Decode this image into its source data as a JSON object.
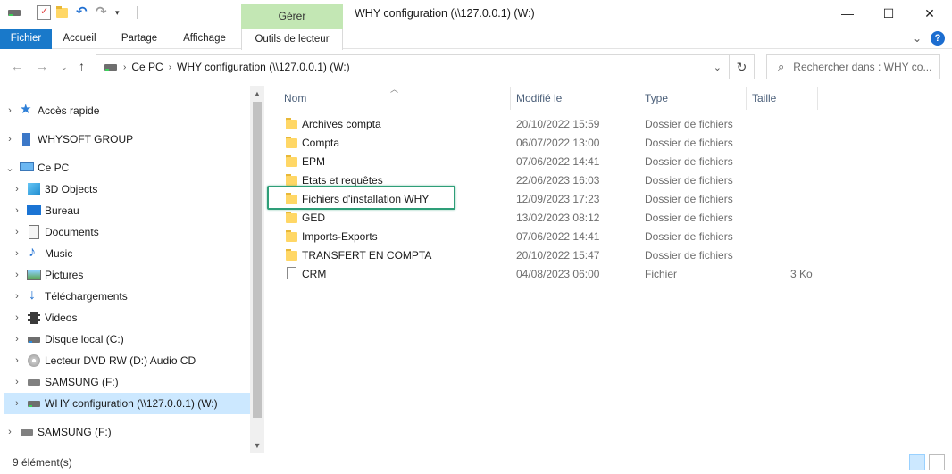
{
  "titlebar": {
    "context_tab": "Gérer",
    "title": "WHY configuration (\\\\127.0.0.1) (W:)",
    "minimize_glyph": "—",
    "maximize_glyph": "☐",
    "close_glyph": "✕"
  },
  "ribbon": {
    "tabs": [
      "Fichier",
      "Accueil",
      "Partage",
      "Affichage",
      "Outils de lecteur"
    ],
    "help_glyph": "?",
    "expand_glyph": "⌄"
  },
  "address": {
    "crumbs": [
      "Ce PC",
      "WHY configuration (\\\\127.0.0.1) (W:)"
    ],
    "search_placeholder": "Rechercher dans : WHY co..."
  },
  "nav": {
    "items": [
      {
        "label": "Accès rapide",
        "icon": "quick-access-star-icon"
      },
      {
        "label": "WHYSOFT GROUP",
        "icon": "building-icon"
      },
      {
        "label": "Ce PC",
        "icon": "computer-icon"
      },
      {
        "label": "3D Objects",
        "icon": "3d-objects-icon"
      },
      {
        "label": "Bureau",
        "icon": "desktop-icon"
      },
      {
        "label": "Documents",
        "icon": "documents-icon"
      },
      {
        "label": "Music",
        "icon": "music-icon"
      },
      {
        "label": "Pictures",
        "icon": "pictures-icon"
      },
      {
        "label": "Téléchargements",
        "icon": "downloads-icon"
      },
      {
        "label": "Videos",
        "icon": "videos-icon"
      },
      {
        "label": "Disque local (C:)",
        "icon": "local-disk-icon"
      },
      {
        "label": "Lecteur DVD RW (D:) Audio CD",
        "icon": "dvd-drive-icon"
      },
      {
        "label": "SAMSUNG (F:)",
        "icon": "usb-drive-icon"
      },
      {
        "label": "WHY configuration (\\\\127.0.0.1) (W:)",
        "icon": "network-drive-icon"
      },
      {
        "label": "SAMSUNG (F:)",
        "icon": "usb-drive-icon"
      }
    ]
  },
  "columns": {
    "name": "Nom",
    "modified": "Modifié le",
    "type": "Type",
    "size": "Taille"
  },
  "files": [
    {
      "name": "Archives compta",
      "modified": "20/10/2022 15:59",
      "type": "Dossier de fichiers",
      "size": ""
    },
    {
      "name": "Compta",
      "modified": "06/07/2022 13:00",
      "type": "Dossier de fichiers",
      "size": ""
    },
    {
      "name": "EPM",
      "modified": "07/06/2022 14:41",
      "type": "Dossier de fichiers",
      "size": ""
    },
    {
      "name": "Etats et requêtes",
      "modified": "22/06/2023 16:03",
      "type": "Dossier de fichiers",
      "size": ""
    },
    {
      "name": "Fichiers d'installation WHY",
      "modified": "12/09/2023 17:23",
      "type": "Dossier de fichiers",
      "size": ""
    },
    {
      "name": "GED",
      "modified": "13/02/2023 08:12",
      "type": "Dossier de fichiers",
      "size": ""
    },
    {
      "name": "Imports-Exports",
      "modified": "07/06/2022 14:41",
      "type": "Dossier de fichiers",
      "size": ""
    },
    {
      "name": "TRANSFERT EN COMPTA",
      "modified": "20/10/2022 15:47",
      "type": "Dossier de fichiers",
      "size": ""
    },
    {
      "name": "CRM",
      "modified": "04/08/2023 06:00",
      "type": "Fichier",
      "size": "3 Ko"
    }
  ],
  "status": {
    "item_count": "9 élément(s)"
  },
  "colors": {
    "file_tab": "#1979ca",
    "context_tab": "#c3e7b4",
    "highlight_border": "#2e9e78",
    "selected_nav": "#cce8ff"
  }
}
